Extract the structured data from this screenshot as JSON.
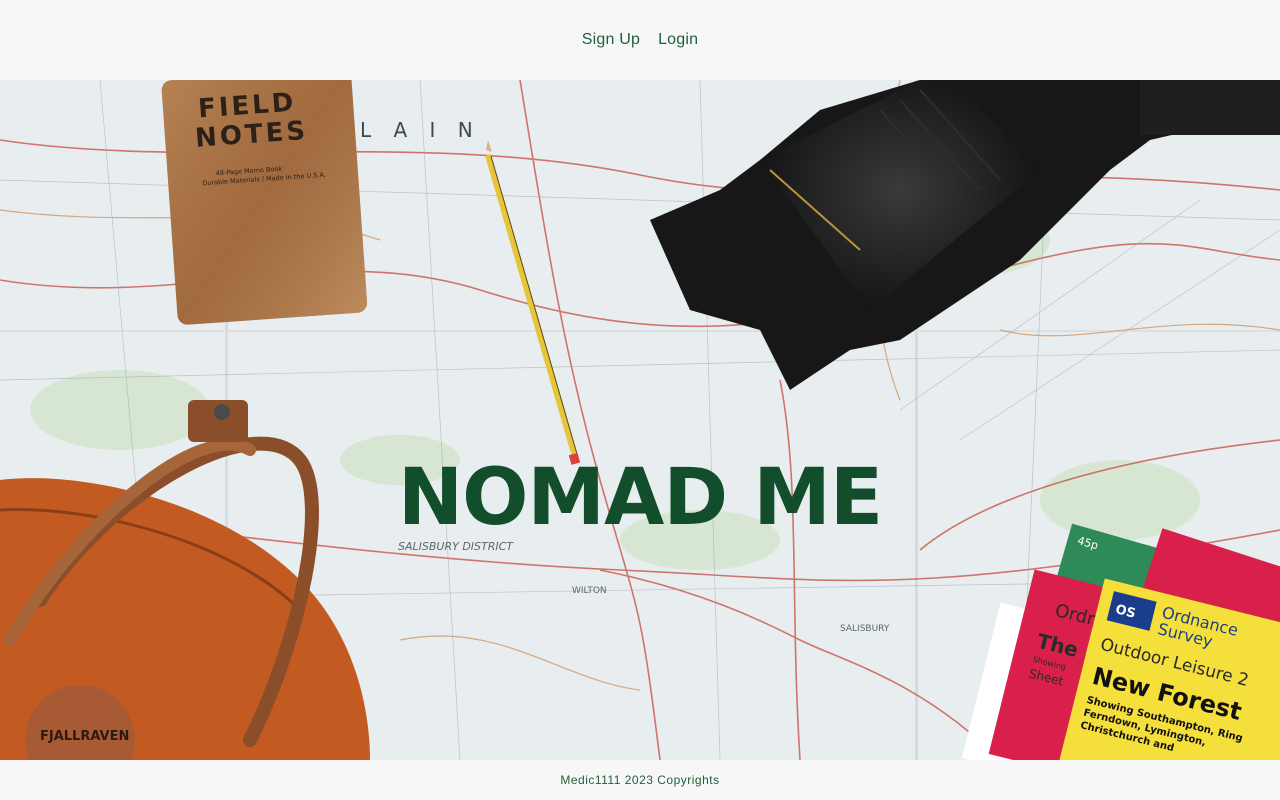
{
  "nav": {
    "signup_label": "Sign Up",
    "login_label": "Login"
  },
  "hero": {
    "title": "NOMAD ME",
    "notebook": {
      "line1": "FIELD",
      "line2": "NOTES",
      "sub1": "48-Page Memo Book",
      "sub2": "Durable Materials / Made in the U.S.A."
    },
    "map_labels": {
      "district": "SALISBURY DISTRICT",
      "town1": "WILTON",
      "town2": "SALISBURY",
      "top": "L A I N"
    },
    "os_map": {
      "brand1": "Ordnance",
      "brand2": "Survey",
      "series": "Outdoor Leisure 2",
      "name": "New Forest",
      "place1": "Showing Southampton, Ring",
      "place2": "Ferndown, Lymington,",
      "place3": "Christchurch and",
      "price": "45p",
      "back_label": "Ordnance",
      "back_title": "The",
      "back_sub": "Showing",
      "back_sheet": "Sheet"
    },
    "bag_brand": "FJALLRAVEN"
  },
  "footer": {
    "copyright": "Medic1111 2023 Copyrights"
  },
  "colors": {
    "accent": "#1f5f3a",
    "title": "#134e2c",
    "page_bg": "#f7f7f7"
  }
}
